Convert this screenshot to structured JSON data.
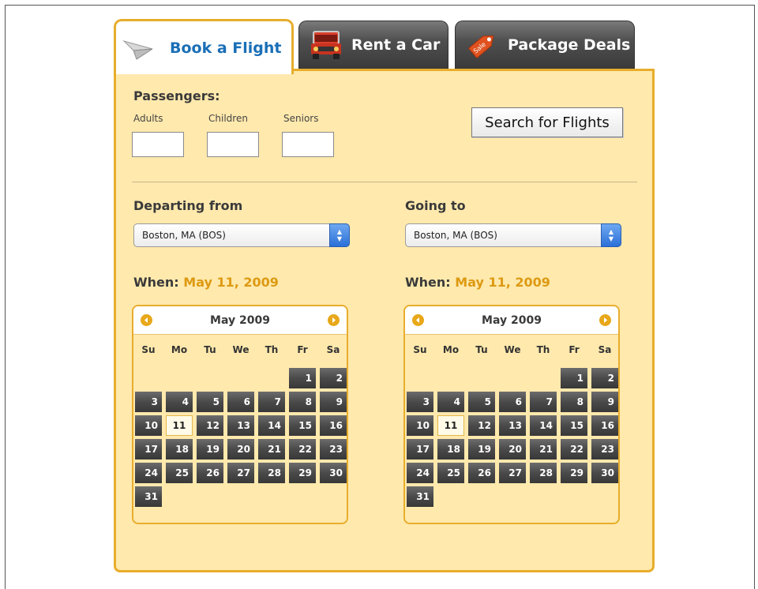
{
  "tabs": [
    {
      "label": "Book a Flight",
      "icon": "paper-plane-icon",
      "active": true
    },
    {
      "label": "Rent a Car",
      "icon": "car-icon",
      "active": false
    },
    {
      "label": "Package Deals",
      "icon": "sale-tag-icon",
      "active": false
    }
  ],
  "sale_tag_text": "Sale",
  "passengers": {
    "title": "Passengers:",
    "adults_label": "Adults",
    "children_label": "Children",
    "seniors_label": "Seniors",
    "adults_value": "",
    "children_value": "",
    "seniors_value": ""
  },
  "search_button_label": "Search for Flights",
  "departing": {
    "title": "Departing from",
    "selected": "Boston, MA (BOS)",
    "when_label": "When:",
    "when_date": "May 11, 2009"
  },
  "going": {
    "title": "Going to",
    "selected": "Boston, MA (BOS)",
    "when_label": "When:",
    "when_date": "May 11, 2009"
  },
  "calendar": {
    "month_label": "May 2009",
    "weekdays": [
      "Su",
      "Mo",
      "Tu",
      "We",
      "Th",
      "Fr",
      "Sa"
    ],
    "first_weekday_index": 5,
    "days_in_month": 31,
    "selected_day": 11
  },
  "colors": {
    "accent": "#e8ad2c",
    "panel_bg": "#ffe9ad",
    "active_tab_text": "#1a6fb7",
    "date_highlight": "#dd9a12"
  }
}
